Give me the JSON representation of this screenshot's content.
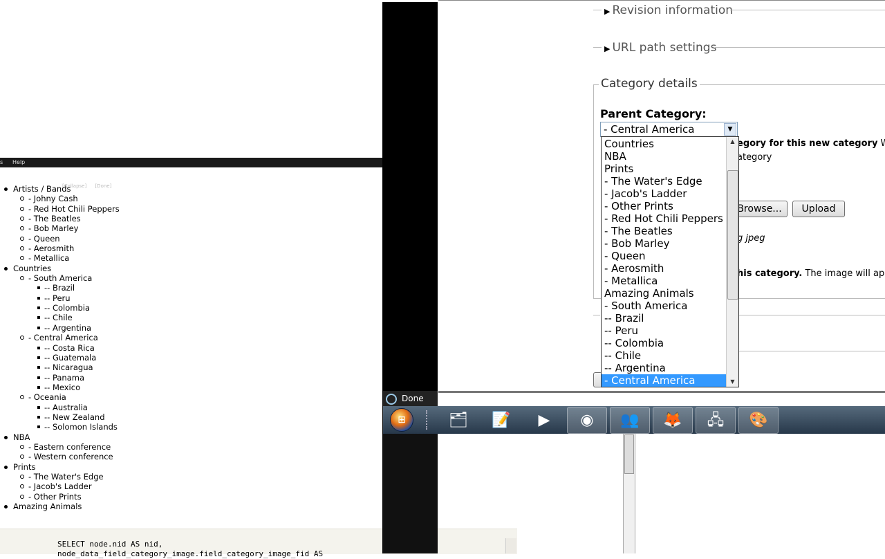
{
  "menubar": {
    "help": "Help",
    "left_fragment": "s"
  },
  "ghost_text": [
    "[Collapse]",
    "[Done]"
  ],
  "tree": [
    {
      "label": "Artists / Bands",
      "children": [
        {
          "label": "- Johny Cash"
        },
        {
          "label": "- Red Hot Chili Peppers"
        },
        {
          "label": "- The Beatles"
        },
        {
          "label": "- Bob Marley"
        },
        {
          "label": "- Queen"
        },
        {
          "label": "- Aerosmith"
        },
        {
          "label": "- Metallica"
        }
      ]
    },
    {
      "label": "Countries",
      "children": [
        {
          "label": "- South America",
          "children": [
            "-- Brazil",
            "-- Peru",
            "-- Colombia",
            "-- Chile",
            "-- Argentina"
          ]
        },
        {
          "label": "- Central America",
          "children": [
            "-- Costa Rica",
            "-- Guatemala",
            "-- Nicaragua",
            "-- Panama",
            "-- Mexico"
          ]
        },
        {
          "label": "- Oceania",
          "children": [
            "-- Australia",
            "-- New Zealand",
            "-- Solomon Islands"
          ]
        }
      ]
    },
    {
      "label": "NBA",
      "children": [
        {
          "label": "- Eastern conference"
        },
        {
          "label": "- Western conference"
        }
      ]
    },
    {
      "label": "Prints",
      "children": [
        {
          "label": "- The Water's Edge"
        },
        {
          "label": "- Jacob's Ladder"
        },
        {
          "label": "- Other Prints"
        }
      ]
    },
    {
      "label": "Amazing Animals",
      "children": []
    }
  ],
  "sql": {
    "line1": "SELECT node.nid AS nid,",
    "line2": "node_data_field_category_image.field_category_image_fid AS"
  },
  "status": {
    "done": "Done"
  },
  "form": {
    "revision_info": "Revision information",
    "url_path": "URL path settings",
    "category_details": "Category details",
    "parent_label": "Parent Category:",
    "selected_value": "- Central America",
    "desc_fragment_bold": "egory for this new category",
    "desc_fragment_rest": " W",
    "desc_fragment2": "ategory",
    "browse_label": "Browse...",
    "upload_label": "Upload",
    "jpeg_fragment": "g jpeg",
    "image_fragment_bold": "his category.",
    "image_fragment_rest": " The image will app"
  },
  "dropdown_options": [
    "Countries",
    "NBA",
    "Prints",
    "- The Water's Edge",
    "- Jacob's Ladder",
    "- Other Prints",
    "- Red Hot Chili Peppers",
    "- The Beatles",
    "- Bob Marley",
    "- Queen",
    "- Aerosmith",
    "- Metallica",
    "Amazing Animals",
    "- South America",
    "-- Brazil",
    "-- Peru",
    "-- Colombia",
    "-- Chile",
    "-- Argentina",
    "- Central America"
  ],
  "selected_option_index": 19,
  "taskbar": [
    {
      "name": "explorer-icon",
      "glyph": "🗂"
    },
    {
      "name": "notepad-icon",
      "glyph": "📝"
    },
    {
      "name": "media-player-icon",
      "glyph": "▶"
    },
    {
      "name": "chrome-icon",
      "glyph": "◉"
    },
    {
      "name": "messenger-icon",
      "glyph": "👥"
    },
    {
      "name": "firefox-icon",
      "glyph": "🦊"
    },
    {
      "name": "network-tool-icon",
      "glyph": "🖧"
    },
    {
      "name": "paint-icon",
      "glyph": "🎨"
    }
  ],
  "colors": {
    "accent_selected": "#3399ff",
    "taskbar": "#2f4357"
  }
}
